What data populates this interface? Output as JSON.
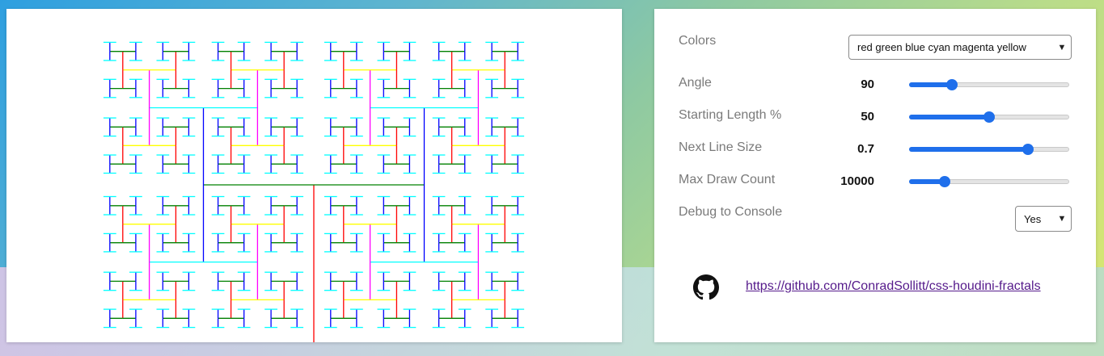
{
  "colors": [
    "#ff0000",
    "#008000",
    "#0000ff",
    "#00ffff",
    "#ff00ff",
    "#ffff00"
  ],
  "slider_accent": "#1f6feb",
  "controls": {
    "colors_label": "Colors",
    "colors_value": "red green blue cyan magenta yellow",
    "angle_label": "Angle",
    "angle_value": "90",
    "angle_position": 0.27,
    "length_label": "Starting Length %",
    "length_value": "50",
    "length_position": 0.5,
    "line_size_label": "Next Line Size",
    "line_size_value": "0.7",
    "line_size_position": 0.74,
    "max_draw_label": "Max Draw Count",
    "max_draw_value": "10000",
    "max_draw_position": 0.22,
    "debug_label": "Debug to Console",
    "debug_value": "Yes"
  },
  "footer": {
    "github_icon": "github-icon",
    "link_text": "https://github.com/ConradSollitt/css-houdini-fractals"
  }
}
